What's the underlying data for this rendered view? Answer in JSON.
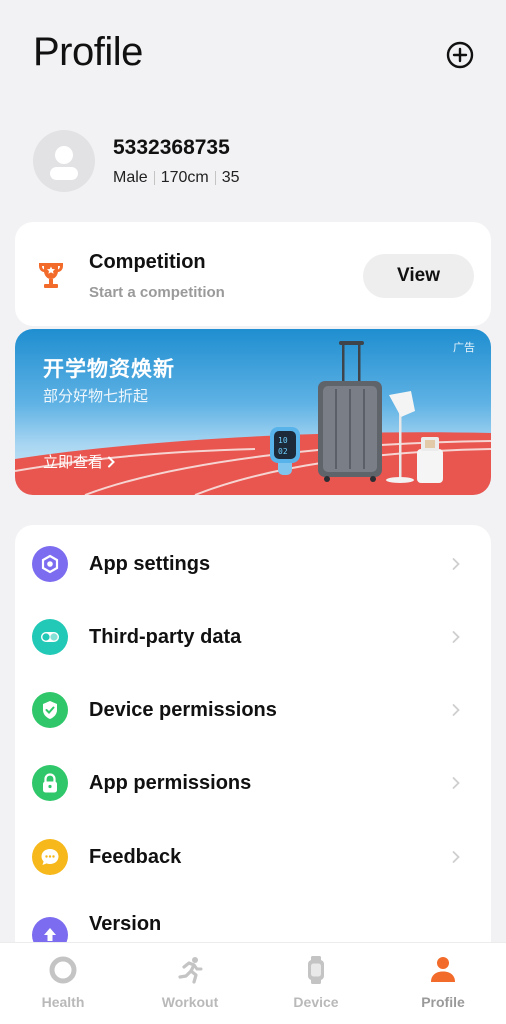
{
  "header": {
    "title": "Profile",
    "add_icon": "plus-circle-icon"
  },
  "user": {
    "id": "5332368735",
    "gender": "Male",
    "height": "170cm",
    "age": "35",
    "avatar_icon": "person-icon"
  },
  "competition": {
    "title": "Competition",
    "subtitle": "Start a competition",
    "button_label": "View",
    "icon": "trophy-icon"
  },
  "banner": {
    "ad_tag": "广告",
    "title": "开学物资焕新",
    "subtitle": "部分好物七折起",
    "cta": "立即查看",
    "watch_time_top": "10",
    "watch_time_bottom": "02"
  },
  "menu": {
    "items": [
      {
        "label": "App settings",
        "icon": "settings-icon",
        "color": "#7b6cf0"
      },
      {
        "label": "Third-party data",
        "icon": "toggle-link-icon",
        "color": "#22c9b6"
      },
      {
        "label": "Device permissions",
        "icon": "shield-check-icon",
        "color": "#2fc76a"
      },
      {
        "label": "App permissions",
        "icon": "lock-icon",
        "color": "#2fc76a"
      },
      {
        "label": "Feedback",
        "icon": "chat-bubble-icon",
        "color": "#f6b81a"
      },
      {
        "label": "Version",
        "icon": "upload-arrow-icon",
        "color": "#7b6cf0"
      }
    ]
  },
  "tabbar": {
    "tabs": [
      {
        "label": "Health",
        "icon": "ring-icon"
      },
      {
        "label": "Workout",
        "icon": "runner-icon"
      },
      {
        "label": "Device",
        "icon": "watch-icon"
      },
      {
        "label": "Profile",
        "icon": "person-icon",
        "active": true
      }
    ]
  },
  "colors": {
    "accent": "#f26b2a",
    "background": "#f2f2f4",
    "banner_blue": "#1f8ed0",
    "track_red": "#e9554f"
  }
}
